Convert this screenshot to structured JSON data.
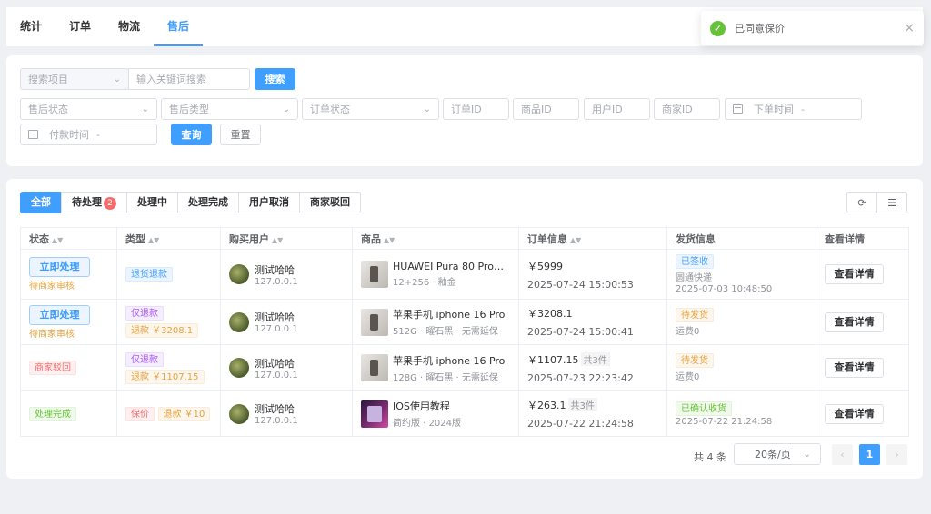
{
  "top_tabs": [
    {
      "label": "统计"
    },
    {
      "label": "订单"
    },
    {
      "label": "物流"
    },
    {
      "label": "售后",
      "active": true
    }
  ],
  "toast": {
    "message": "已同意保价",
    "icon": "check-circle-icon",
    "close": "×"
  },
  "filters": {
    "search_scope": "搜索项目",
    "keyword_placeholder": "输入关键词搜索",
    "search_button": "搜索",
    "after_sale_status": "售后状态",
    "after_sale_type": "售后类型",
    "order_status": "订单状态",
    "order_id": "订单ID",
    "product_id": "商品ID",
    "user_id": "用户ID",
    "merchant_id": "商家ID",
    "order_time": "下单时间",
    "order_time_sep": "-",
    "pay_time": "付款时间",
    "pay_time_sep": "-",
    "query_button": "查询",
    "reset_button": "重置"
  },
  "status_tabs": [
    {
      "label": "全部",
      "active": true
    },
    {
      "label": "待处理",
      "badge": "2"
    },
    {
      "label": "处理中"
    },
    {
      "label": "处理完成"
    },
    {
      "label": "用户取消"
    },
    {
      "label": "商家驳回"
    }
  ],
  "toolbar": {
    "refresh_icon": "refresh-icon",
    "columns_icon": "sliders-icon"
  },
  "table": {
    "headers": [
      "状态",
      "类型",
      "购买用户",
      "商品",
      "订单信息",
      "发货信息",
      "查看详情"
    ],
    "rows": [
      {
        "status_button": "立即处理",
        "status_sub": "待商家审核",
        "type_tags": [
          "退货退款"
        ],
        "user": "测试哈哈",
        "ip": "127.0.0.1",
        "product": "HUAWEI Pura 80 ProHU...",
        "spec": "12+256 · 釉金",
        "price": "￥5999",
        "count": "",
        "time": "2025-07-24 15:00:53",
        "ship_tag": "已签收",
        "ship_line1": "圆通快递",
        "ship_line2": "2025-07-03 10:48:50",
        "detail": "查看详情"
      },
      {
        "status_button": "立即处理",
        "status_sub": "待商家审核",
        "type_tags": [
          "仅退款",
          "退款 ￥3208.1"
        ],
        "user": "测试哈哈",
        "ip": "127.0.0.1",
        "product": "苹果手机 iphone 16 Pro",
        "spec": "512G · 曜石黑 · 无需延保",
        "price": "￥3208.1",
        "count": "",
        "time": "2025-07-24 15:00:41",
        "ship_tag": "待发货",
        "ship_line1": "运费0",
        "ship_line2": "",
        "detail": "查看详情"
      },
      {
        "status_tag": "商家驳回",
        "type_tags": [
          "仅退款",
          "退款 ￥1107.15"
        ],
        "user": "测试哈哈",
        "ip": "127.0.0.1",
        "product": "苹果手机 iphone 16 Pro",
        "spec": "128G · 曜石黑 · 无需延保",
        "price": "￥1107.15",
        "count": "共3件",
        "time": "2025-07-23 22:23:42",
        "ship_tag": "待发货",
        "ship_line1": "运费0",
        "ship_line2": "",
        "detail": "查看详情"
      },
      {
        "status_tag": "处理完成",
        "type_tags": [
          "保价",
          "退款 ￥10"
        ],
        "user": "测试哈哈",
        "ip": "127.0.0.1",
        "product": "IOS使用教程",
        "spec": "简约版 · 2024版",
        "price": "￥263.1",
        "count": "共3件",
        "time": "2025-07-22 21:24:58",
        "ship_tag": "已确认收货",
        "ship_line1": "2025-07-22 21:24:58",
        "ship_line2": "",
        "detail": "查看详情"
      }
    ]
  },
  "pagination": {
    "total": "共 4 条",
    "page_size": "20条/页",
    "prev": "‹",
    "current": "1",
    "next": "›"
  },
  "colors": {
    "primary": "#409eff",
    "success": "#67c23a",
    "warning": "#e6a23c",
    "danger": "#f56c6c"
  }
}
